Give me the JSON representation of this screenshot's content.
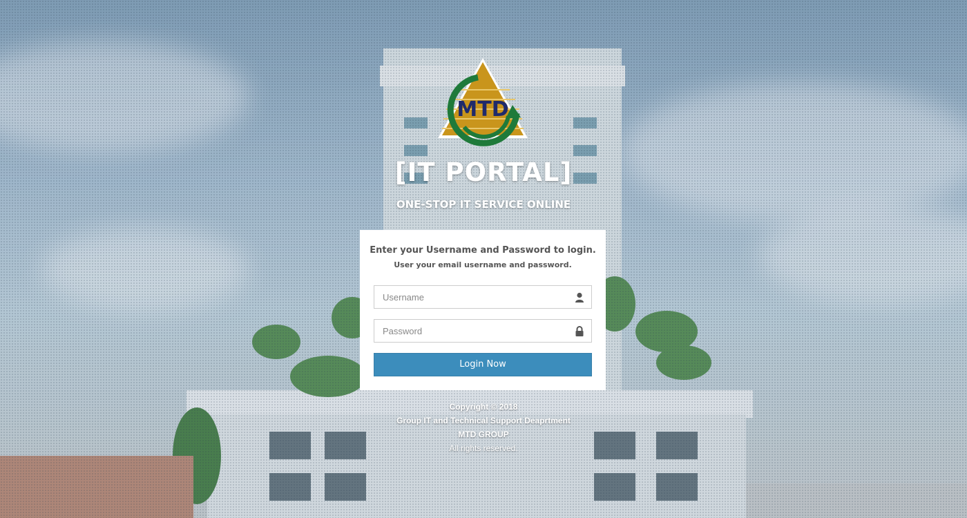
{
  "brand": {
    "logo_text": "MTD",
    "colors": {
      "gold": "#c9951c",
      "green": "#1f7a3a",
      "navy": "#1f2a6b",
      "accent_blue": "#3c8dbc"
    }
  },
  "header": {
    "title": "[IT PORTAL]",
    "subtitle": "ONE-STOP IT SERVICE ONLINE"
  },
  "login": {
    "heading": "Enter your Username and Password to login.",
    "subheading": "User your email username and password.",
    "username": {
      "placeholder": "Username",
      "value": "",
      "icon": "user-icon"
    },
    "password": {
      "placeholder": "Password",
      "value": "",
      "icon": "lock-icon"
    },
    "submit_label": "Login Now"
  },
  "footer": {
    "copyright": "Copyright © 2018",
    "department": "Group IT and Technical Support Deaprtment",
    "company": "MTD GROUP",
    "rights": "All rights reserved."
  }
}
